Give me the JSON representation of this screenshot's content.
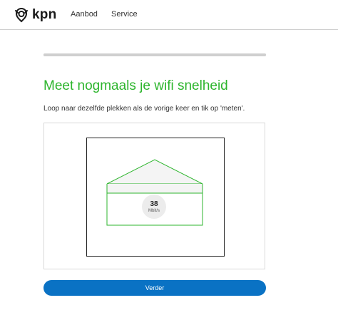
{
  "header": {
    "brand": "kpn",
    "nav": [
      {
        "label": "Aanbod"
      },
      {
        "label": "Service"
      }
    ]
  },
  "progress": {
    "fraction": 1.0
  },
  "main": {
    "title": "Meet nogmaals je wifi snelheid",
    "subtitle": "Loop naar dezelfde plekken als de vorige keer en tik op 'meten'."
  },
  "measurement": {
    "value": "38",
    "unit": "Mbit/s"
  },
  "actions": {
    "next_label": "Verder"
  },
  "colors": {
    "brand_green": "#2db52d",
    "button_blue": "#0a72c4"
  },
  "icons": {
    "logo": "kpn-logo-icon"
  }
}
